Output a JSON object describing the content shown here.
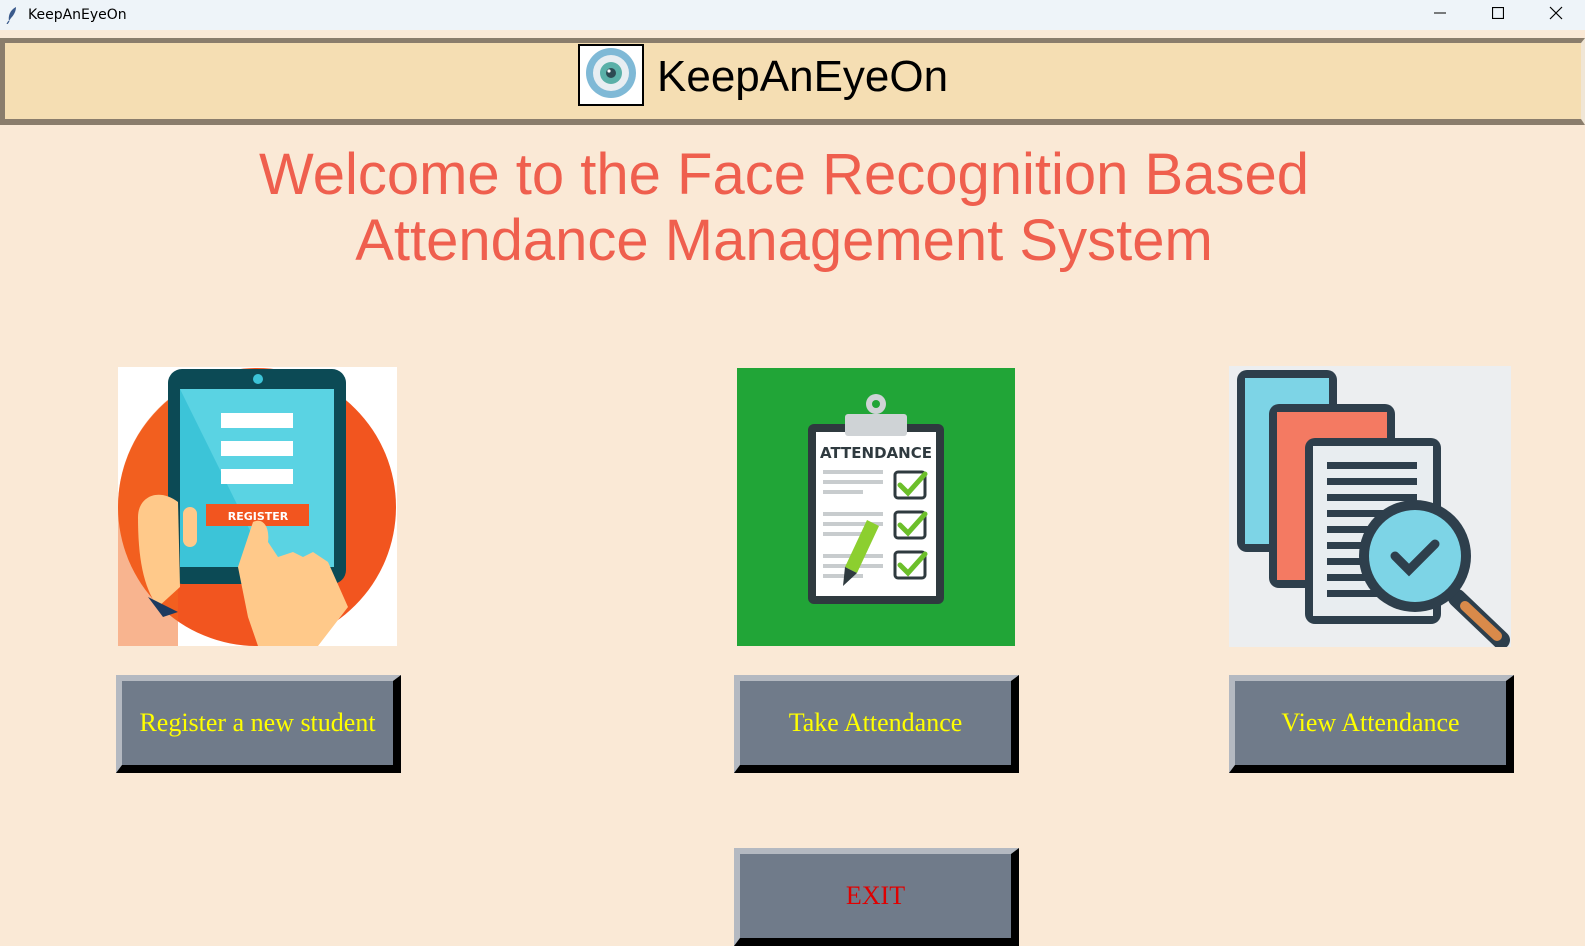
{
  "window": {
    "title": "KeepAnEyeOn",
    "controls": [
      "minimize-icon",
      "maximize-icon",
      "close-icon"
    ]
  },
  "header": {
    "brand": "KeepAnEyeOn",
    "logo_icon": "eye-icon"
  },
  "welcome": {
    "line1": "Welcome to the Face Recognition Based",
    "line2": "Attendance Management System"
  },
  "features": [
    {
      "image_icon": "register-tablet-icon",
      "image_text": "REGISTER",
      "button_label": "Register a new student"
    },
    {
      "image_icon": "attendance-clipboard-icon",
      "image_text": "ATTENDANCE",
      "button_label": "Take Attendance"
    },
    {
      "image_icon": "view-documents-magnifier-icon",
      "button_label": "View Attendance"
    }
  ],
  "exit": {
    "label": "EXIT"
  },
  "colors": {
    "background": "#fae9d6",
    "header": "#f5deb3",
    "welcome_text": "#ef5f4e",
    "button_bg": "#707b8a",
    "button_text": "#ffff00",
    "exit_text": "#e00000"
  }
}
